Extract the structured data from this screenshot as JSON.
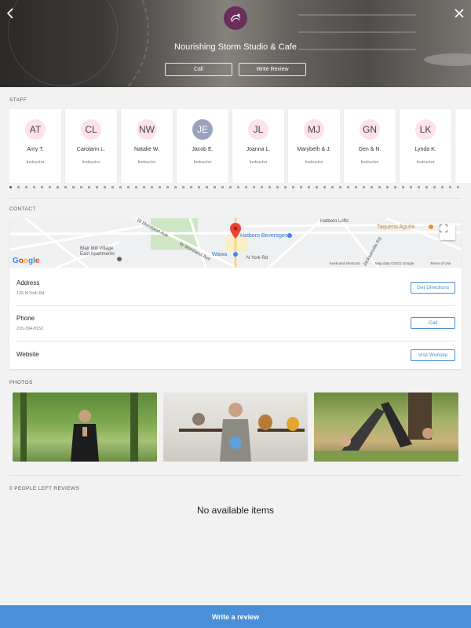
{
  "header": {
    "title": "Nourishing Storm Studio & Cafe",
    "call_label": "Call",
    "write_review_label": "Write Review",
    "back_icon": "chevron-left-icon",
    "close_icon": "close-icon"
  },
  "staff": {
    "section_label": "STAFF",
    "members": [
      {
        "initials": "AT",
        "name": "Amy T.",
        "role": "Instructor"
      },
      {
        "initials": "CL",
        "name": "Carolann L.",
        "role": "Instructor"
      },
      {
        "initials": "NW",
        "name": "Natalie W.",
        "role": "Instructor"
      },
      {
        "initials": "JE",
        "name": "Jacob E.",
        "role": "Instructor"
      },
      {
        "initials": "JL",
        "name": "Joanna L.",
        "role": "Instructor"
      },
      {
        "initials": "MJ",
        "name": "Marybeth & J.",
        "role": "Instructor"
      },
      {
        "initials": "GN",
        "name": "Gen & N.",
        "role": "Instructor"
      },
      {
        "initials": "LK",
        "name": "Lynda K.",
        "role": "Instructor"
      }
    ]
  },
  "contact": {
    "section_label": "CONTACT",
    "map": {
      "labels": {
        "blair": "Blair Mill Village",
        "blair2": "East Apartments",
        "hatboro_bev": "Hatboro Beverages",
        "wawa": "Wawa",
        "taqueria": "Taqueria Aguila",
        "hatboro_lofts": "Hatboro Lofts",
        "w_moreland": "W Moreland Ave",
        "w_moreland2": "W Moreland Ave",
        "jacksonville": "Jacksonville Rd",
        "n_york": "N York Rd"
      },
      "google_letters": [
        "G",
        "o",
        "o",
        "g",
        "l",
        "e"
      ],
      "google_colors": [
        "#4285F4",
        "#EA4335",
        "#FBBC05",
        "#4285F4",
        "#34A853",
        "#EA4335"
      ],
      "keyboard_shortcuts": "Keyboard shortcuts",
      "map_data": "Map data ©2021 Google",
      "terms": "Terms of Use"
    },
    "address": {
      "label": "Address",
      "value": "126 N York Rd",
      "action": "Get Directions"
    },
    "phone": {
      "label": "Phone",
      "value": "215-394-8152",
      "action": "Call"
    },
    "website": {
      "label": "Website",
      "action": "Visit Website"
    }
  },
  "photos": {
    "section_label": "PHOTOS"
  },
  "reviews": {
    "section_label": "0 PEOPLE LEFT REVIEWS",
    "empty_text": "No available items"
  },
  "footer": {
    "write_review": "Write a review"
  },
  "colors": {
    "accent": "#4a90d9",
    "logo": "#6b2d5c",
    "avatar_pink": "#fde2ea",
    "avatar_grey": "#9aa3bd"
  }
}
